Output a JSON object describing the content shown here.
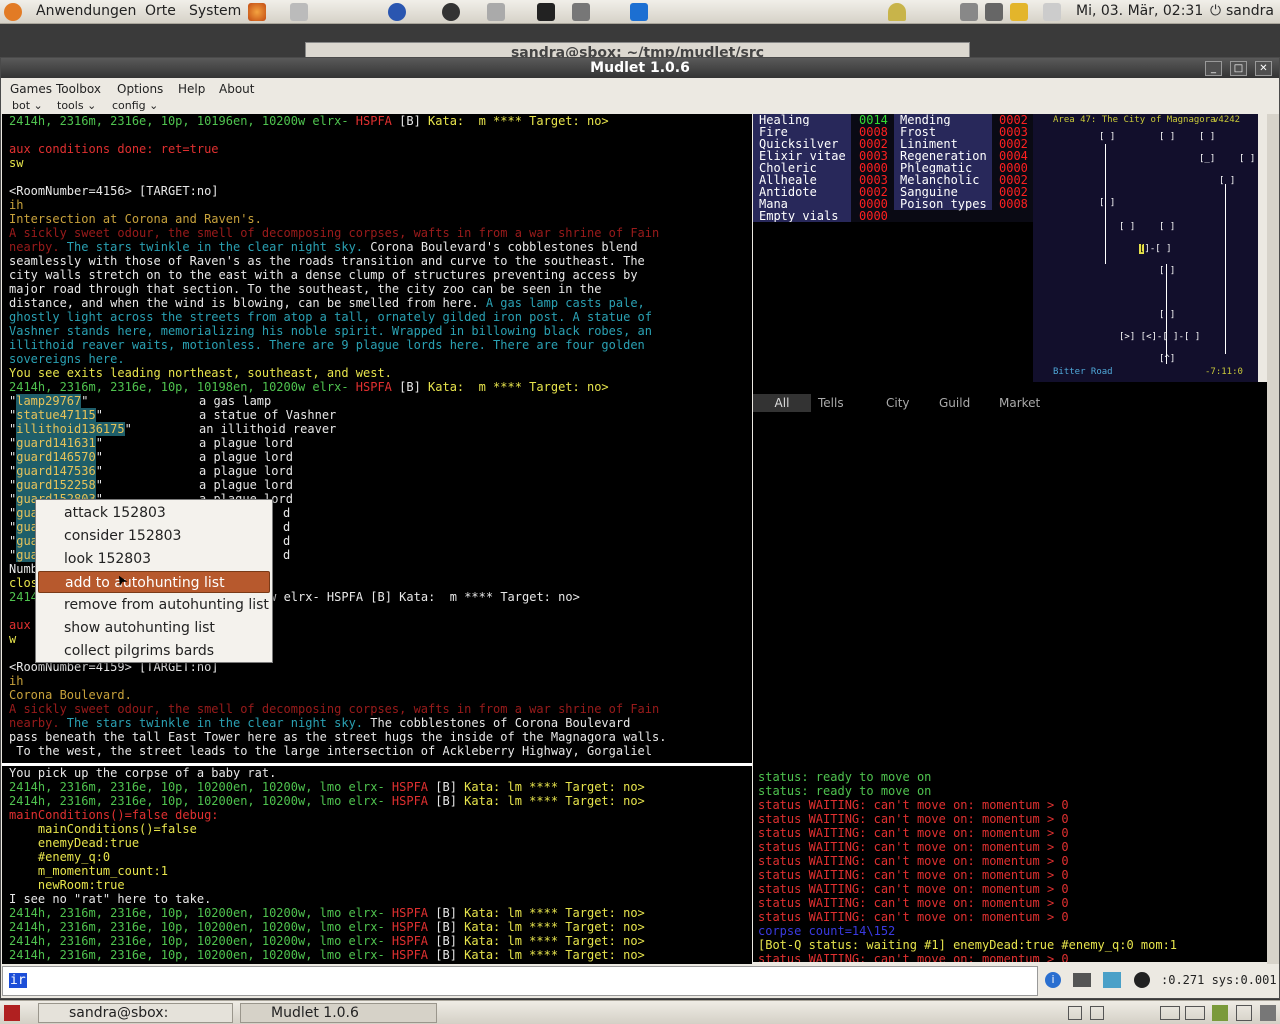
{
  "topbar": {
    "menu": [
      "Anwendungen",
      "Orte",
      "System"
    ],
    "clock": "Mi, 03. Mär, 02:31",
    "user": "sandra"
  },
  "bg_window_title": "sandra@sbox: ~/tmp/mudlet/src",
  "window": {
    "title": "Mudlet 1.0.6"
  },
  "menubar": [
    "Games",
    "Toolbox",
    "Options",
    "Help",
    "About"
  ],
  "toolbar": [
    "bot",
    "tools",
    "config"
  ],
  "main_output": [
    {
      "t": "2414h, 2316m, 2316e, 10p, 10196en, 10200w elrx- HSPFA [B] Kata:  m **** Target: no>",
      "s": "prompt"
    },
    {
      "t": "",
      "s": "w"
    },
    {
      "t": "aux conditions done: ret=true",
      "s": "r"
    },
    {
      "t": "sw",
      "s": "y"
    },
    {
      "t": "",
      "s": "w"
    },
    {
      "t": "<RoomNumber=4156> [TARGET:no]",
      "s": "w"
    },
    {
      "t": "ih",
      "s": "o"
    },
    {
      "t": "Intersection at Corona and Raven's.",
      "s": "o"
    },
    {
      "t": "A sickly sweet odour, the smell of decomposing corpses, wafts in from a war shrine of Fain",
      "s": "dr"
    },
    {
      "t": "nearby.",
      "s": "dr",
      "rest": [
        {
          "t": " The stars twinkle in the clear night sky.",
          "s": "c"
        },
        {
          "t": " Corona Boulevard's cobblestones blend",
          "s": "w"
        }
      ]
    },
    {
      "t": "seamlessly with those of Raven's as the roads transition and curve to the southeast. The",
      "s": "w"
    },
    {
      "t": "city walls stretch on to the east with a dense clump of structures preventing access by",
      "s": "w"
    },
    {
      "t": "major road through that section. To the southeast, the city zoo can be seen in the",
      "s": "w"
    },
    {
      "t": "distance, and when the wind is blowing, can be smelled from here.",
      "s": "w",
      "rest": [
        {
          "t": " A gas lamp casts pale,",
          "s": "c"
        }
      ]
    },
    {
      "t": "ghostly light across the streets from atop a tall, ornately gilded iron post. A statue of",
      "s": "c"
    },
    {
      "t": "Vashner stands here, memorializing his noble spirit. Wrapped in billowing black robes, an",
      "s": "c"
    },
    {
      "t": "illithoid reaver waits, motionless. There are 9 plague lords here. There are four golden",
      "s": "c"
    },
    {
      "t": "sovereigns here.",
      "s": "c"
    },
    {
      "t": "You see exits leading northeast, southeast, and west.",
      "s": "y"
    },
    {
      "t": "2414h, 2316m, 2316e, 10p, 10198en, 10200w elrx- HSPFA [B] Kata:  m **** Target: no>",
      "s": "prompt"
    }
  ],
  "items": [
    {
      "id": "lamp29767",
      "desc": "a gas lamp"
    },
    {
      "id": "statue47115",
      "desc": "a statue of Vashner"
    },
    {
      "id": "illithoid136175",
      "desc": "an illithoid reaver"
    },
    {
      "id": "guard141631",
      "desc": "a plague lord"
    },
    {
      "id": "guard146570",
      "desc": "a plague lord"
    },
    {
      "id": "guard147536",
      "desc": "a plague lord"
    },
    {
      "id": "guard152258",
      "desc": "a plague lord"
    },
    {
      "id": "guard152803",
      "desc": "a plague lord"
    },
    {
      "id": "gua",
      "desc": "d"
    },
    {
      "id": "gua",
      "desc": "d"
    },
    {
      "id": "gua",
      "desc": "d"
    },
    {
      "id": "gua",
      "desc": "d"
    }
  ],
  "main_output2": [
    {
      "t": "Numb",
      "s": "w"
    },
    {
      "t": "clos",
      "s": "y"
    },
    {
      "t": "2414",
      "s": "g",
      "tail": "0w elrx- HSPFA [B] Kata:  m **** Target: no>"
    },
    {
      "t": "",
      "s": "w"
    },
    {
      "t": "aux",
      "s": "r"
    },
    {
      "t": "w",
      "s": "y"
    },
    {
      "t": "",
      "s": "w"
    },
    {
      "t": "<RoomNumber=4159> [TARGET:no]",
      "s": "w"
    },
    {
      "t": "ih",
      "s": "o"
    },
    {
      "t": "Corona Boulevard.",
      "s": "o"
    },
    {
      "t": "A sickly sweet odour, the smell of decomposing corpses, wafts in from a war shrine of Fain",
      "s": "dr"
    },
    {
      "t": "nearby.",
      "s": "dr",
      "rest": [
        {
          "t": " The stars twinkle in the clear night sky.",
          "s": "c"
        },
        {
          "t": " The cobblestones of Corona Boulevard",
          "s": "w"
        }
      ]
    },
    {
      "t": "pass beneath the tall East Tower here as the street hugs the inside of the Magnagora walls.",
      "s": "w"
    },
    {
      "t": " To the west, the street leads to the large intersection of Ackleberry Highway, Gorgaliel",
      "s": "w"
    }
  ],
  "lower_output": [
    {
      "t": "You pick up the corpse of a baby rat.",
      "s": "w"
    },
    {
      "t": "2414h, 2316m, 2316e, 10p, 10200en, 10200w, lmo elrx- HSPFA [B] Kata: lm **** Target: no>",
      "s": "prompt"
    },
    {
      "t": "2414h, 2316m, 2316e, 10p, 10200en, 10200w, lmo elrx- HSPFA [B] Kata: lm **** Target: no>",
      "s": "prompt"
    },
    {
      "t": "mainConditions()=false debug:",
      "s": "r"
    },
    {
      "t": "    mainConditions()=false",
      "s": "y"
    },
    {
      "t": "    enemyDead:true",
      "s": "y"
    },
    {
      "t": "    #enemy_q:0",
      "s": "y"
    },
    {
      "t": "    m_momentum_count:1",
      "s": "y"
    },
    {
      "t": "    newRoom:true",
      "s": "y"
    },
    {
      "t": "I see no \"rat\" here to take.",
      "s": "w"
    },
    {
      "t": "2414h, 2316m, 2316e, 10p, 10200en, 10200w, lmo elrx- HSPFA [B] Kata: lm **** Target: no>",
      "s": "prompt"
    },
    {
      "t": "2414h, 2316m, 2316e, 10p, 10200en, 10200w, lmo elrx- HSPFA [B] Kata: lm **** Target: no>",
      "s": "prompt"
    },
    {
      "t": "2414h, 2316m, 2316e, 10p, 10200en, 10200w, lmo elrx- HSPFA [B] Kata: lm **** Target: no>",
      "s": "prompt"
    },
    {
      "t": "2414h, 2316m, 2316e, 10p, 10200en, 10200w, lmo elrx- HSPFA [B] Kata: lm **** Target: no>",
      "s": "prompt"
    }
  ],
  "right_output": [
    {
      "t": "status: ready to move on",
      "s": "g"
    },
    {
      "t": "status: ready to move on",
      "s": "g"
    },
    {
      "t": "status WAITING: can't move on: momentum > 0",
      "s": "r"
    },
    {
      "t": "status WAITING: can't move on: momentum > 0",
      "s": "r"
    },
    {
      "t": "status WAITING: can't move on: momentum > 0",
      "s": "r"
    },
    {
      "t": "status WAITING: can't move on: momentum > 0",
      "s": "r"
    },
    {
      "t": "status WAITING: can't move on: momentum > 0",
      "s": "r"
    },
    {
      "t": "status WAITING: can't move on: momentum > 0",
      "s": "r"
    },
    {
      "t": "status WAITING: can't move on: momentum > 0",
      "s": "r"
    },
    {
      "t": "status WAITING: can't move on: momentum > 0",
      "s": "r"
    },
    {
      "t": "status WAITING: can't move on: momentum > 0",
      "s": "r"
    },
    {
      "t": "corpse count=14\\152",
      "s": "bl"
    },
    {
      "t": "[Bot-Q status: waiting #1] enemyDead:true #enemy_q:0 mom:1",
      "s": "y"
    },
    {
      "t": "status WAITING: can't move on: momentum > 0",
      "s": "r"
    },
    {
      "t": "status WAITING: can't move on: momentum > 0",
      "s": "r"
    },
    {
      "t": "status WAITING: can't move on: momentum > 0",
      "s": "r"
    }
  ],
  "inventory": [
    {
      "label": "Healing",
      "value": "0014",
      "vcolor": "#33dd33",
      "label2": "Mending",
      "value2": "0002"
    },
    {
      "label": "Fire",
      "value": "0008",
      "vcolor": "#ff2020",
      "label2": "Frost",
      "value2": "0003"
    },
    {
      "label": "Quicksilver",
      "value": "0002",
      "vcolor": "#ff2020",
      "label2": "Liniment",
      "value2": "0002"
    },
    {
      "label": "Elixir vitae",
      "value": "0003",
      "vcolor": "#ff2020",
      "label2": "Regeneration",
      "value2": "0004"
    },
    {
      "label": "Choleric",
      "value": "0000",
      "vcolor": "#ff2020",
      "label2": "Phlegmatic",
      "value2": "0000"
    },
    {
      "label": "Allheale",
      "value": "0003",
      "vcolor": "#ff2020",
      "label2": "Melancholic",
      "value2": "0002"
    },
    {
      "label": "Antidote",
      "value": "0002",
      "vcolor": "#ff2020",
      "label2": "Sanguine",
      "value2": "0002"
    },
    {
      "label": "Mana",
      "value": "0000",
      "vcolor": "#ff2020",
      "label2": "Poison types",
      "value2": "0008"
    },
    {
      "label": "Empty vials",
      "value": "0000",
      "vcolor": "#ff2020",
      "label2": "",
      "value2": ""
    }
  ],
  "mapper": {
    "title": "Area 47: The City of Magnagora",
    "version": "v4242",
    "room_name": "Bitter Road",
    "coords": "-7:11:0"
  },
  "tabs": [
    "All",
    "Tells",
    "City",
    "Guild",
    "Market"
  ],
  "input": {
    "value": "ir"
  },
  "status_text": ":0.271 sys:0.001",
  "context_menu": [
    "attack 152803",
    "consider 152803",
    "look 152803",
    "add to autohunting list",
    "remove from autohunting list",
    "show autohunting list",
    "collect pilgrims bards"
  ],
  "context_selected": 3,
  "taskbar": [
    {
      "label": "sandra@sbox: ~/tmp/..."
    },
    {
      "label": "Mudlet 1.0.6"
    }
  ],
  "colors": {
    "prompt_green": "#4fc34f",
    "alert_red": "#e03030",
    "yellow": "#e7e44c",
    "cyan": "#2aa1b3",
    "menu_select": "#b7592d"
  }
}
